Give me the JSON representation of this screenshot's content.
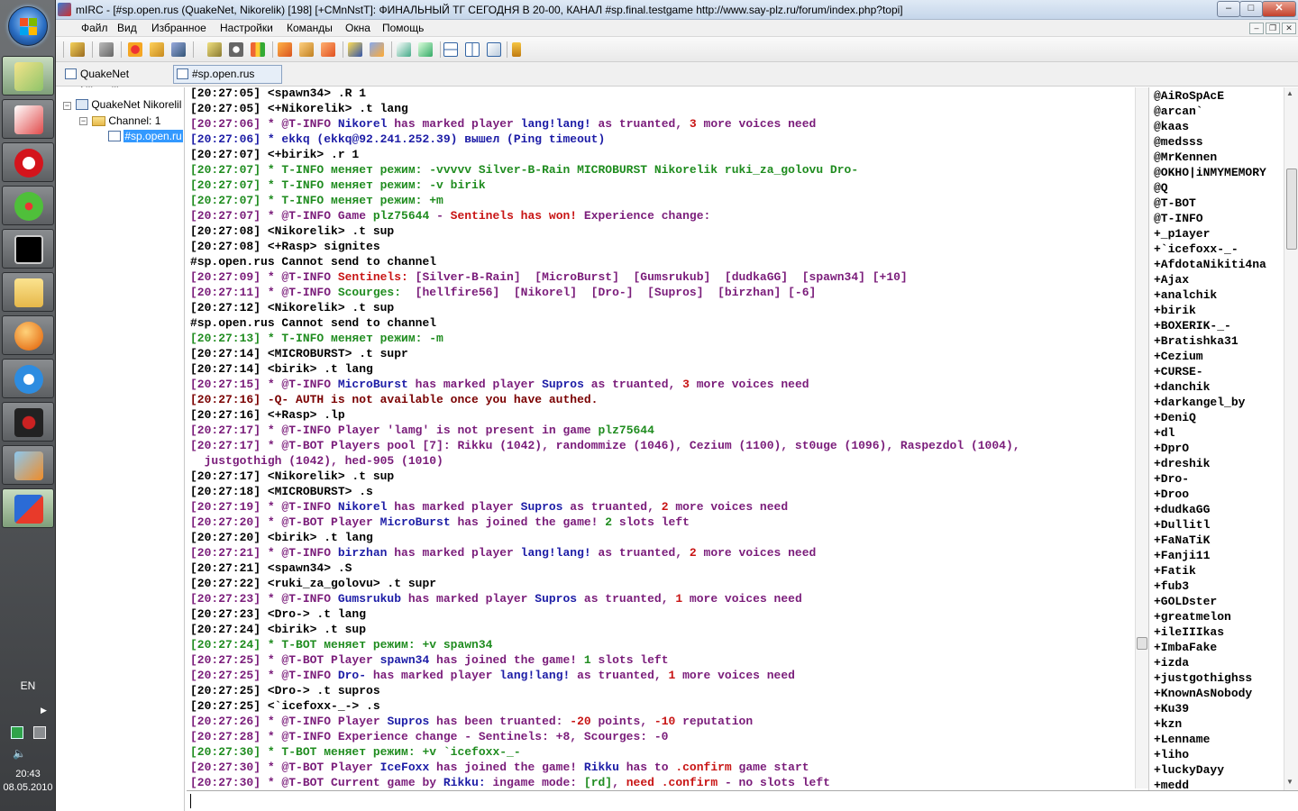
{
  "taskbar": {
    "language": "EN",
    "clock_time": "20:43",
    "clock_date": "08.05.2010",
    "buttons": [
      "windows-explorer-icon",
      "files-icon",
      "opera-icon",
      "icq-icon",
      "cmd-icon",
      "folders-icon",
      "media-player-icon",
      "messenger-icon",
      "game-icon",
      "video-icon",
      "mirc-icon"
    ]
  },
  "window": {
    "title": "mIRC - [#sp.open.rus (QuakeNet, Nikorelik) [198] [+CMnNstT]: ФИНАЛЬНЫЙ ТГ СЕГОДНЯ В 20-00, КАНАЛ #sp.final.testgame http://www.say-plz.ru/forum/index.php?topi]",
    "caption_minimize": "–",
    "caption_maximize": "□",
    "caption_close": "✕"
  },
  "menu": [
    "Файл",
    "Вид",
    "Избранное",
    "Настройки",
    "Команды",
    "Окна",
    "Помощь"
  ],
  "switchbar": {
    "network": "QuakeNet Nikorelik",
    "channel": "#sp.open.rus"
  },
  "tree": {
    "root": "QuakeNet Nikorelil",
    "folder": "Channel: 1",
    "channel": "#sp.open.ru"
  },
  "colors": {
    "black": "#000000",
    "green": "#1f8c1f",
    "purple": "#7a1c7a",
    "blue": "#1c1ca6",
    "red": "#c81414",
    "darkred": "#7a0000"
  },
  "chat": [
    [
      [
        "[20:27:05] <spawn34> .R 1",
        "black"
      ]
    ],
    [
      [
        "[20:27:05] <+Nikorelik> .t lang",
        "black"
      ]
    ],
    [
      [
        "[20:27:06] * @T-INFO ",
        "purple"
      ],
      [
        "Nikorel",
        "blue"
      ],
      [
        " has marked player ",
        "purple"
      ],
      [
        "lang!lang!",
        "blue"
      ],
      [
        " as truanted, ",
        "purple"
      ],
      [
        "3",
        "red"
      ],
      [
        " more voices need",
        "purple"
      ]
    ],
    [
      [
        "[20:27:06] * ekkq (ekkq@92.241.252.39) вышел (Ping timeout)",
        "blue"
      ]
    ],
    [
      [
        "[20:27:07] <+birik> .r 1",
        "black"
      ]
    ],
    [
      [
        "[20:27:07] * T-INFO меняет режим: -vvvvv Silver-B-Rain MICROBURST Nikorelik ruki_za_golovu Dro-",
        "green"
      ]
    ],
    [
      [
        "[20:27:07] * T-INFO меняет режим: -v birik",
        "green"
      ]
    ],
    [
      [
        "[20:27:07] * T-INFO меняет режим: +m",
        "green"
      ]
    ],
    [
      [
        "[20:27:07] * @T-INFO Game ",
        "purple"
      ],
      [
        "plz75644",
        "green"
      ],
      [
        " - ",
        "purple"
      ],
      [
        "Sentinels has won!",
        "red"
      ],
      [
        " Experience change:",
        "purple"
      ]
    ],
    [
      [
        "[20:27:08] <Nikorelik> .t sup",
        "black"
      ]
    ],
    [
      [
        "[20:27:08] <+Rasp> signites",
        "black"
      ]
    ],
    [
      [
        "#sp.open.rus Cannot send to channel",
        "black"
      ]
    ],
    [
      [
        "[20:27:09] * @T-INFO ",
        "purple"
      ],
      [
        "Sentinels:",
        "red"
      ],
      [
        " [Silver-B-Rain]  [MicroBurst]  [Gumsrukub]  [dudkaGG]  [spawn34] [+10]",
        "purple"
      ]
    ],
    [
      [
        "[20:27:11] * @T-INFO ",
        "purple"
      ],
      [
        "Scourges:",
        "green"
      ],
      [
        "  [hellfire56]  [Nikorel]  [Dro-]  [Supros]  [birzhan] [-6]",
        "purple"
      ]
    ],
    [
      [
        "[20:27:12] <Nikorelik> .t sup",
        "black"
      ]
    ],
    [
      [
        "#sp.open.rus Cannot send to channel",
        "black"
      ]
    ],
    [
      [
        "[20:27:13] * T-INFO меняет режим: -m",
        "green"
      ]
    ],
    [
      [
        "[20:27:14] <MICROBURST> .t supr",
        "black"
      ]
    ],
    [
      [
        "[20:27:14] <birik> .t lang",
        "black"
      ]
    ],
    [
      [
        "[20:27:15] * @T-INFO ",
        "purple"
      ],
      [
        "MicroBurst",
        "blue"
      ],
      [
        " has marked player ",
        "purple"
      ],
      [
        "Supros",
        "blue"
      ],
      [
        " as truanted, ",
        "purple"
      ],
      [
        "3",
        "red"
      ],
      [
        " more voices need",
        "purple"
      ]
    ],
    [
      [
        "[20:27:16] -Q- AUTH is not available once you have authed.",
        "darkred"
      ]
    ],
    [
      [
        "[20:27:16] <+Rasp> .lp",
        "black"
      ]
    ],
    [
      [
        "[20:27:17] * @T-INFO Player 'lamg' is not present in game ",
        "purple"
      ],
      [
        "plz75644",
        "green"
      ]
    ],
    [
      [
        "[20:27:17] * @T-BOT Players pool [7]: Rikku (1042), randommize (1046), Cezium (1100), st0uge (1096), Raspezdol (1004),",
        "purple"
      ]
    ],
    [
      [
        "  justgothigh (1042), hed-905 (1010)",
        "purple"
      ]
    ],
    [
      [
        "[20:27:17] <Nikorelik> .t sup",
        "black"
      ]
    ],
    [
      [
        "[20:27:18] <MICROBURST> .s",
        "black"
      ]
    ],
    [
      [
        "[20:27:19] * @T-INFO ",
        "purple"
      ],
      [
        "Nikorel",
        "blue"
      ],
      [
        " has marked player ",
        "purple"
      ],
      [
        "Supros",
        "blue"
      ],
      [
        " as truanted, ",
        "purple"
      ],
      [
        "2",
        "red"
      ],
      [
        " more voices need",
        "purple"
      ]
    ],
    [
      [
        "[20:27:20] * @T-BOT Player ",
        "purple"
      ],
      [
        "MicroBurst",
        "blue"
      ],
      [
        " has joined the game! ",
        "purple"
      ],
      [
        "2",
        "green"
      ],
      [
        " slots left",
        "purple"
      ]
    ],
    [
      [
        "[20:27:20] <birik> .t lang",
        "black"
      ]
    ],
    [
      [
        "[20:27:21] * @T-INFO ",
        "purple"
      ],
      [
        "birzhan",
        "blue"
      ],
      [
        " has marked player ",
        "purple"
      ],
      [
        "lang!lang!",
        "blue"
      ],
      [
        " as truanted, ",
        "purple"
      ],
      [
        "2",
        "red"
      ],
      [
        " more voices need",
        "purple"
      ]
    ],
    [
      [
        "[20:27:21] <spawn34> .S",
        "black"
      ]
    ],
    [
      [
        "[20:27:22] <ruki_za_golovu> .t supr",
        "black"
      ]
    ],
    [
      [
        "[20:27:23] * @T-INFO ",
        "purple"
      ],
      [
        "Gumsrukub",
        "blue"
      ],
      [
        " has marked player ",
        "purple"
      ],
      [
        "Supros",
        "blue"
      ],
      [
        " as truanted, ",
        "purple"
      ],
      [
        "1",
        "red"
      ],
      [
        " more voices need",
        "purple"
      ]
    ],
    [
      [
        "[20:27:23] <Dro-> .t lang",
        "black"
      ]
    ],
    [
      [
        "[20:27:24] <birik> .t sup",
        "black"
      ]
    ],
    [
      [
        "[20:27:24] * T-BOT меняет режим: +v spawn34",
        "green"
      ]
    ],
    [
      [
        "[20:27:25] * @T-BOT Player ",
        "purple"
      ],
      [
        "spawn34",
        "blue"
      ],
      [
        " has joined the game! ",
        "purple"
      ],
      [
        "1",
        "green"
      ],
      [
        " slots left",
        "purple"
      ]
    ],
    [
      [
        "[20:27:25] * @T-INFO ",
        "purple"
      ],
      [
        "Dro-",
        "blue"
      ],
      [
        " has marked player ",
        "purple"
      ],
      [
        "lang!lang!",
        "blue"
      ],
      [
        " as truanted, ",
        "purple"
      ],
      [
        "1",
        "red"
      ],
      [
        " more voices need",
        "purple"
      ]
    ],
    [
      [
        "[20:27:25] <Dro-> .t supros",
        "black"
      ]
    ],
    [
      [
        "[20:27:25] <`icefoxx-_-> .s",
        "black"
      ]
    ],
    [
      [
        "[20:27:26] * @T-INFO Player ",
        "purple"
      ],
      [
        "Supros",
        "blue"
      ],
      [
        " has been truanted: ",
        "purple"
      ],
      [
        "-20",
        "red"
      ],
      [
        " points, ",
        "purple"
      ],
      [
        "-10",
        "red"
      ],
      [
        " reputation",
        "purple"
      ]
    ],
    [
      [
        "[20:27:28] * @T-INFO Experience change - Sentinels: +8, Scourges: -0",
        "purple"
      ]
    ],
    [
      [
        "[20:27:30] * T-BOT меняет режим: +v `icefoxx-_-",
        "green"
      ]
    ],
    [
      [
        "[20:27:30] * @T-BOT Player ",
        "purple"
      ],
      [
        "IceFoxx",
        "blue"
      ],
      [
        " has joined the game! ",
        "purple"
      ],
      [
        "Rikku",
        "blue"
      ],
      [
        " has to ",
        "purple"
      ],
      [
        ".confirm",
        "red"
      ],
      [
        " game start",
        "purple"
      ]
    ],
    [
      [
        "[20:27:30] * @T-BOT Current game by ",
        "purple"
      ],
      [
        "Rikku:",
        "blue"
      ],
      [
        " ingame mode: ",
        "purple"
      ],
      [
        "[rd]",
        "green"
      ],
      [
        ", ",
        "purple"
      ],
      [
        "need .confirm",
        "red"
      ],
      [
        " - no slots left",
        "purple"
      ]
    ]
  ],
  "nicks": [
    "@AiRoSpAcE",
    "@arcan`",
    "@kaas",
    "@medsss",
    "@MrKennen",
    "@OKHO|iNMYMEMORY",
    "@Q",
    "@T-BOT",
    "@T-INFO",
    "+_p1ayer",
    "+`icefoxx-_-",
    "+AfdotaNikiti4na",
    "+Ajax",
    "+analchik",
    "+birik",
    "+BOXERIK-_-",
    "+Bratishka31",
    "+Cezium",
    "+CURSE-",
    "+danchik",
    "+darkangel_by",
    "+DeniQ",
    "+dl",
    "+DprO",
    "+dreshik",
    "+Dro-",
    "+Droo",
    "+dudkaGG",
    "+Dullitl",
    "+FaNaTiK",
    "+Fanji11",
    "+Fatik",
    "+fub3",
    "+GOLDster",
    "+greatmelon",
    "+ileIIIkas",
    "+ImbaFake",
    "+izda",
    "+justgothighss",
    "+KnownAsNobody",
    "+Ku39",
    "+kzn",
    "+Lenname",
    "+liho",
    "+luckyDayy",
    "+medd"
  ],
  "editbox": {
    "value": ""
  }
}
